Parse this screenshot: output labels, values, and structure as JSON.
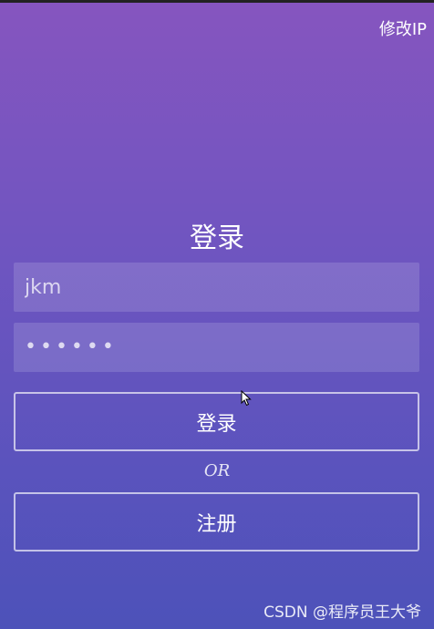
{
  "header": {
    "modify_ip_label": "修改IP"
  },
  "login": {
    "title": "登录",
    "username_value": "jkm",
    "password_display": "••••••",
    "login_button": "登录",
    "or_label": "OR",
    "register_button": "注册"
  },
  "watermark": {
    "text": "CSDN @程序员王大爷"
  },
  "colors": {
    "gradient_top": "#8655bf",
    "gradient_bottom": "#4d52b9",
    "text": "#ffffff"
  },
  "icons": {
    "cursor": "mouse-pointer-icon"
  }
}
